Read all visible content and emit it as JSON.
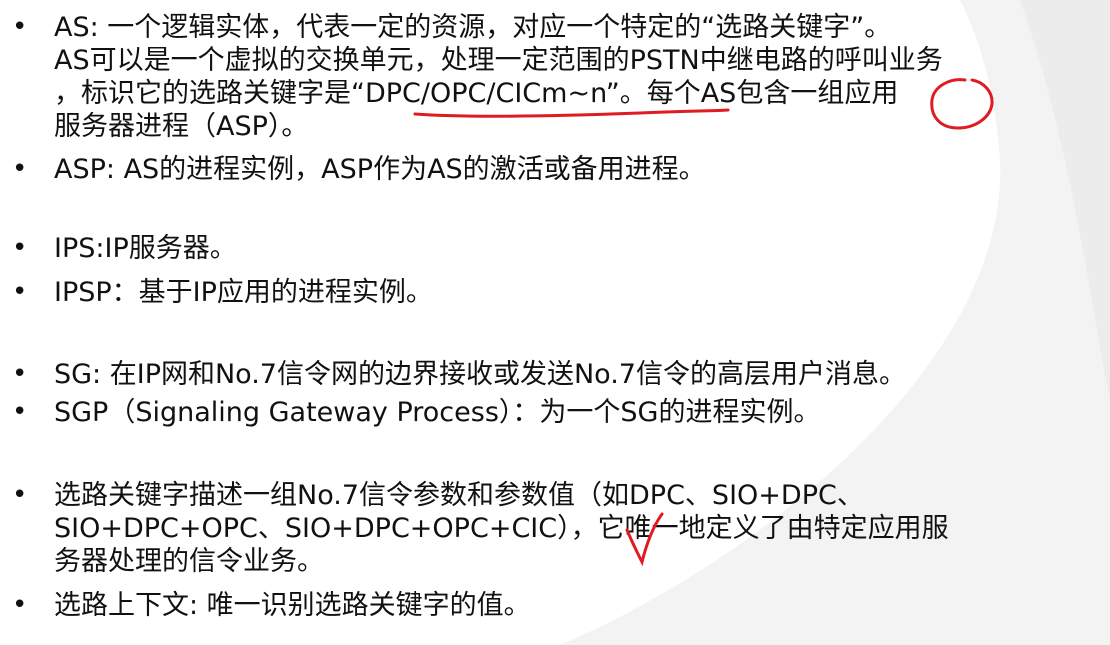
{
  "bullet_glyph": "•",
  "items": [
    {
      "lines": [
        "AS: 一个逻辑实体，代表一定的资源，对应一个特定的“选路关键字”。",
        "AS可以是一个虚拟的交换单元，处理一定范围的PSTN中继电路的呼叫业务",
        "，标识它的选路关键字是“DPC/OPC/CICm~n”。每个AS包含一组应用",
        "服务器进程（ASP）。"
      ]
    },
    {
      "lines": [
        "ASP: AS的进程实例，ASP作为AS的激活或备用进程。"
      ]
    },
    {
      "lines": [
        "IPS:IP服务器。"
      ]
    },
    {
      "lines": [
        "IPSP：基于IP应用的进程实例。"
      ]
    },
    {
      "lines": [
        "SG: 在IP网和No.7信令网的边界接收或发送No.7信令的高层用户消息。"
      ]
    },
    {
      "lines": [
        "SGP（Signaling Gateway Process）：为一个SG的进程实例。"
      ]
    },
    {
      "lines": [
        "选路关键字描述一组No.7信令参数和参数值（如DPC、SIO+DPC、",
        "SIO+DPC+OPC、SIO+DPC+OPC+CIC），它唯一地定义了由特定应用服",
        "务器处理的信令业务。"
      ]
    },
    {
      "lines": [
        "选路上下文: 唯一识别选路关键字的值。"
      ]
    }
  ],
  "colors": {
    "text": "#111111",
    "annotation": "#e11b22",
    "watermark": "#f2f2f2"
  }
}
